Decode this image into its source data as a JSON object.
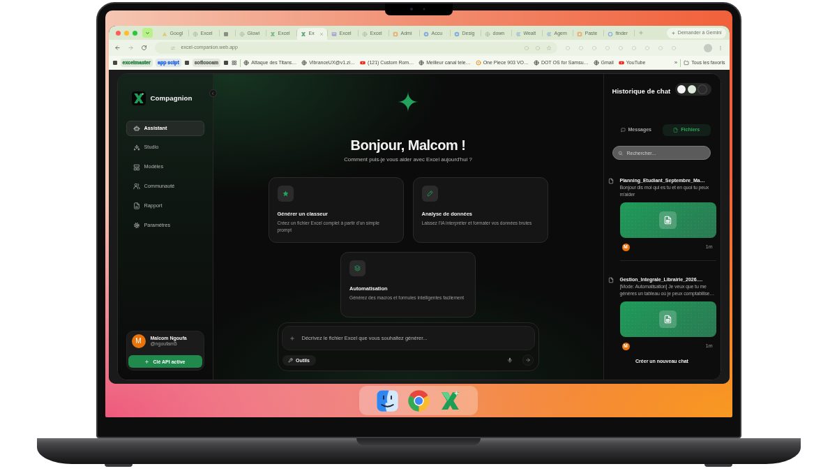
{
  "browser": {
    "tabs": [
      {
        "kind": "triangle",
        "title": "Googl",
        "selected": false
      },
      {
        "kind": "globe",
        "title": "Excel",
        "selected": false
      },
      {
        "kind": "square",
        "selected": false
      },
      {
        "kind": "globe",
        "title": "Glowi",
        "selected": false
      },
      {
        "kind": "xlogo",
        "title": "Excel",
        "selected": false
      },
      {
        "kind": "xlogo",
        "title": "Ex",
        "selected": true
      },
      {
        "kind": "window",
        "title": "Excel",
        "selected": false
      },
      {
        "kind": "globe",
        "title": "Excel",
        "selected": false
      },
      {
        "kind": "tile",
        "title": "Admi",
        "selected": false
      },
      {
        "kind": "circle",
        "title": "Accu",
        "selected": false
      },
      {
        "kind": "circle",
        "title": "Desig",
        "selected": false
      },
      {
        "kind": "globe",
        "title": "down",
        "selected": false
      },
      {
        "kind": "stripes",
        "title": "Wealt",
        "selected": false
      },
      {
        "kind": "stripes",
        "title": "Agem",
        "selected": false
      },
      {
        "kind": "tile",
        "title": "Paste",
        "selected": false
      },
      {
        "kind": "ring",
        "title": "finder",
        "selected": false
      }
    ],
    "gemini_button": "Demander à Gemini",
    "address": "excel-companion.web.app",
    "bookmarks": [
      {
        "kind": "square"
      },
      {
        "kind": "chip",
        "label": "excelmaster",
        "color": "#2e7d46"
      },
      {
        "kind": "chip",
        "label": "app scipt",
        "color": "#2563d8"
      },
      {
        "kind": "square"
      },
      {
        "kind": "chip",
        "label": "soficocam",
        "color": "#5b655d"
      },
      {
        "kind": "square"
      },
      {
        "kind": "grid"
      },
      {
        "kind": "globe",
        "label": "Attaque des Titans…"
      },
      {
        "kind": "globe",
        "label": "VibranceUX@v1.zi…"
      },
      {
        "kind": "video",
        "label": "(121) Custom Rom…"
      },
      {
        "kind": "globe",
        "label": "Meilleur canal tele…"
      },
      {
        "kind": "play",
        "label": "One Piece 903 VO…"
      },
      {
        "kind": "globe",
        "label": "DOT OS for Samsu…"
      },
      {
        "kind": "globe",
        "label": "Gmail"
      },
      {
        "kind": "video",
        "label": "YouTube"
      }
    ],
    "bookmarks_more": "»",
    "all_bookmarks": "Tous les favoris"
  },
  "sidebar": {
    "brand": "Compagnion",
    "nav": [
      {
        "kind": "robot",
        "label": "Assistant",
        "selected": true
      },
      {
        "kind": "sparkles",
        "label": "Studio",
        "selected": false
      },
      {
        "kind": "layout",
        "label": "Modèles",
        "selected": false
      },
      {
        "kind": "users",
        "label": "Communauté",
        "selected": false
      },
      {
        "kind": "report",
        "label": "Rapport",
        "selected": false
      },
      {
        "kind": "gear",
        "label": "Paramètres",
        "selected": false
      }
    ],
    "user": {
      "avatar": "M",
      "name": "Malcom Ngoufa",
      "handle": "@ngoufam5"
    },
    "api_button": "Clé API active"
  },
  "main": {
    "greeting": "Bonjour, Malcom !",
    "subtitle": "Comment puis-je vous aider avec Excel aujourd'hui ?",
    "cards": [
      {
        "kind": "star",
        "title": "Générer un classeur",
        "description": "Créez un fichier Excel complet à partir d'un simple prompt"
      },
      {
        "kind": "pencil",
        "title": "Analyse de données",
        "description": "Laissez l'IA interpréter et formater vos données brutes"
      },
      {
        "kind": "layers",
        "title": "Automatisation",
        "description": "Générez des macros et formules intelligentes facilement"
      }
    ],
    "composer": {
      "placeholder": "Décrivez le fichier Excel que vous souhaitez générer...",
      "tools_button": "Outils"
    }
  },
  "history": {
    "title": "Historique de chat",
    "theme_swatches": [
      {
        "color": "#f4f4f4"
      },
      {
        "color": "#dfe9da"
      },
      {
        "color": "#2a2a2a"
      }
    ],
    "tabs": [
      {
        "kind": "chat",
        "label": "Messages",
        "selected": false
      },
      {
        "kind": "file",
        "label": "Fichiers",
        "selected": true
      }
    ],
    "search": {
      "placeholder": "Rechercher..."
    },
    "items": [
      {
        "title": "Planning_Etudiant_Septembre_Ma…",
        "preview": "Bonjour dis moi qui es tu et en quoi tu peux m'aider",
        "avatar": "M",
        "time": "1m"
      },
      {
        "title": "Gestion_Integrale_Librairie_2026.…",
        "preview": "[Mode: Automatisation] Je veux que tu me génères un tableau où je peux comptabilise…",
        "avatar": "M",
        "time": "1m"
      }
    ],
    "new_chat": "Créer un nouveau chat"
  },
  "dock": [
    {
      "kind": "finder"
    },
    {
      "kind": "chrome"
    },
    {
      "kind": "xapp"
    }
  ]
}
